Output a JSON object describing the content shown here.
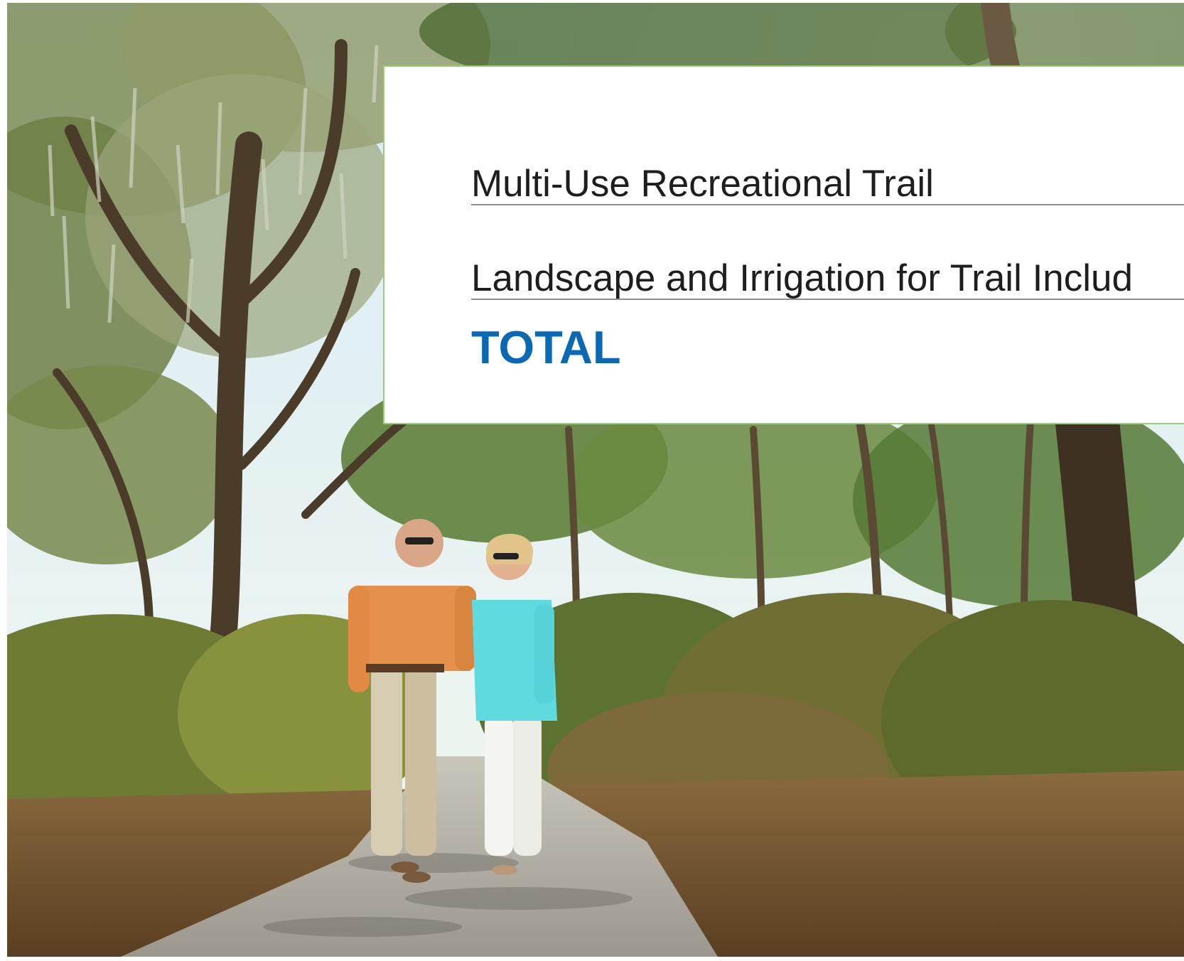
{
  "card": {
    "line_items": [
      "Multi-Use Recreational Trail",
      "Landscape and Irrigation for Trail Includ"
    ],
    "total_label": "TOTAL"
  },
  "colors": {
    "total_text": "#0a69b4",
    "item_text": "#1e1e1e",
    "card_border": "#9ccc7a",
    "divider": "#8f8f8f"
  }
}
